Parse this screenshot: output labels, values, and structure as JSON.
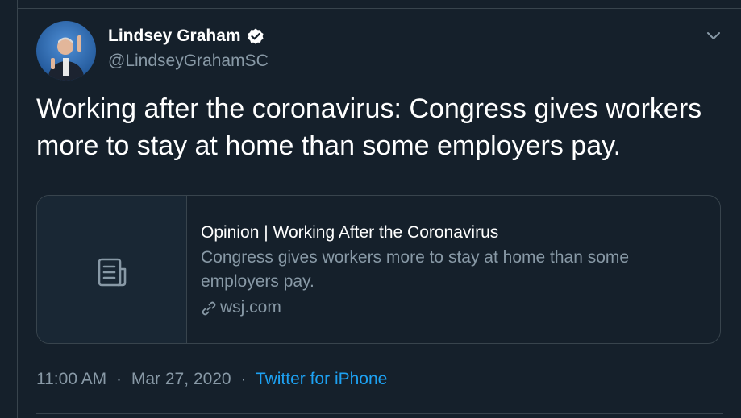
{
  "tweet": {
    "author": {
      "display_name": "Lindsey Graham",
      "handle": "@LindseyGrahamSC",
      "verified": true
    },
    "text": "Working after the coronavirus: Congress gives workers more to stay at home than some employers pay.",
    "card": {
      "title": "Opinion | Working After the Coronavirus",
      "description": "Congress gives workers more to stay at home than some employers pay.",
      "domain": "wsj.com",
      "thumbnail_icon": "document-icon"
    },
    "meta": {
      "time": "11:00 AM",
      "separator": "·",
      "date": "Mar 27, 2020",
      "source": "Twitter for iPhone"
    }
  },
  "icons": {
    "verified": "verified-badge-icon",
    "menu": "chevron-down-icon",
    "link": "link-icon"
  },
  "colors": {
    "background": "#15202b",
    "border": "#38444d",
    "secondary_text": "#8899a6",
    "accent": "#1da1f2"
  }
}
